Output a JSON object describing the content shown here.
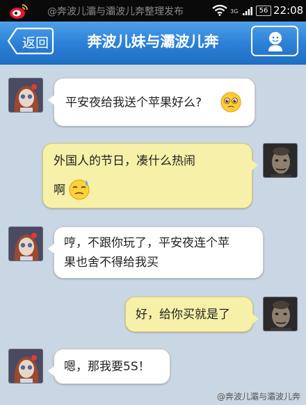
{
  "status_bar": {
    "watermark": "@奔波儿灞与灞波儿奔整理发布",
    "network": "3G",
    "battery": "56",
    "time": "22:08"
  },
  "header": {
    "back_label": "返回",
    "title": "奔波儿妹与灞波儿奔"
  },
  "messages": [
    {
      "side": "in",
      "text": "平安夜给我送个苹果好么?",
      "emoji": "pleading-face-icon"
    },
    {
      "side": "out",
      "text_line1": "外国人的节日，凑什么热闹",
      "text_line2": "啊",
      "emoji": "sweat-face-icon"
    },
    {
      "side": "in",
      "text_line1": "哼，不跟你玩了，平安夜连个苹",
      "text_line2": "果也舍不得给我买"
    },
    {
      "side": "out",
      "text": "好，给你买就是了"
    },
    {
      "side": "in",
      "text": "嗯，那我要5S！"
    }
  ],
  "footer": {
    "watermark": "@奔波儿灞与灞波儿奔"
  },
  "colors": {
    "background": "#c9d6e3",
    "header": "#2a7fd6",
    "bubble_in": "#ffffff",
    "bubble_out": "#f7f0a8"
  }
}
